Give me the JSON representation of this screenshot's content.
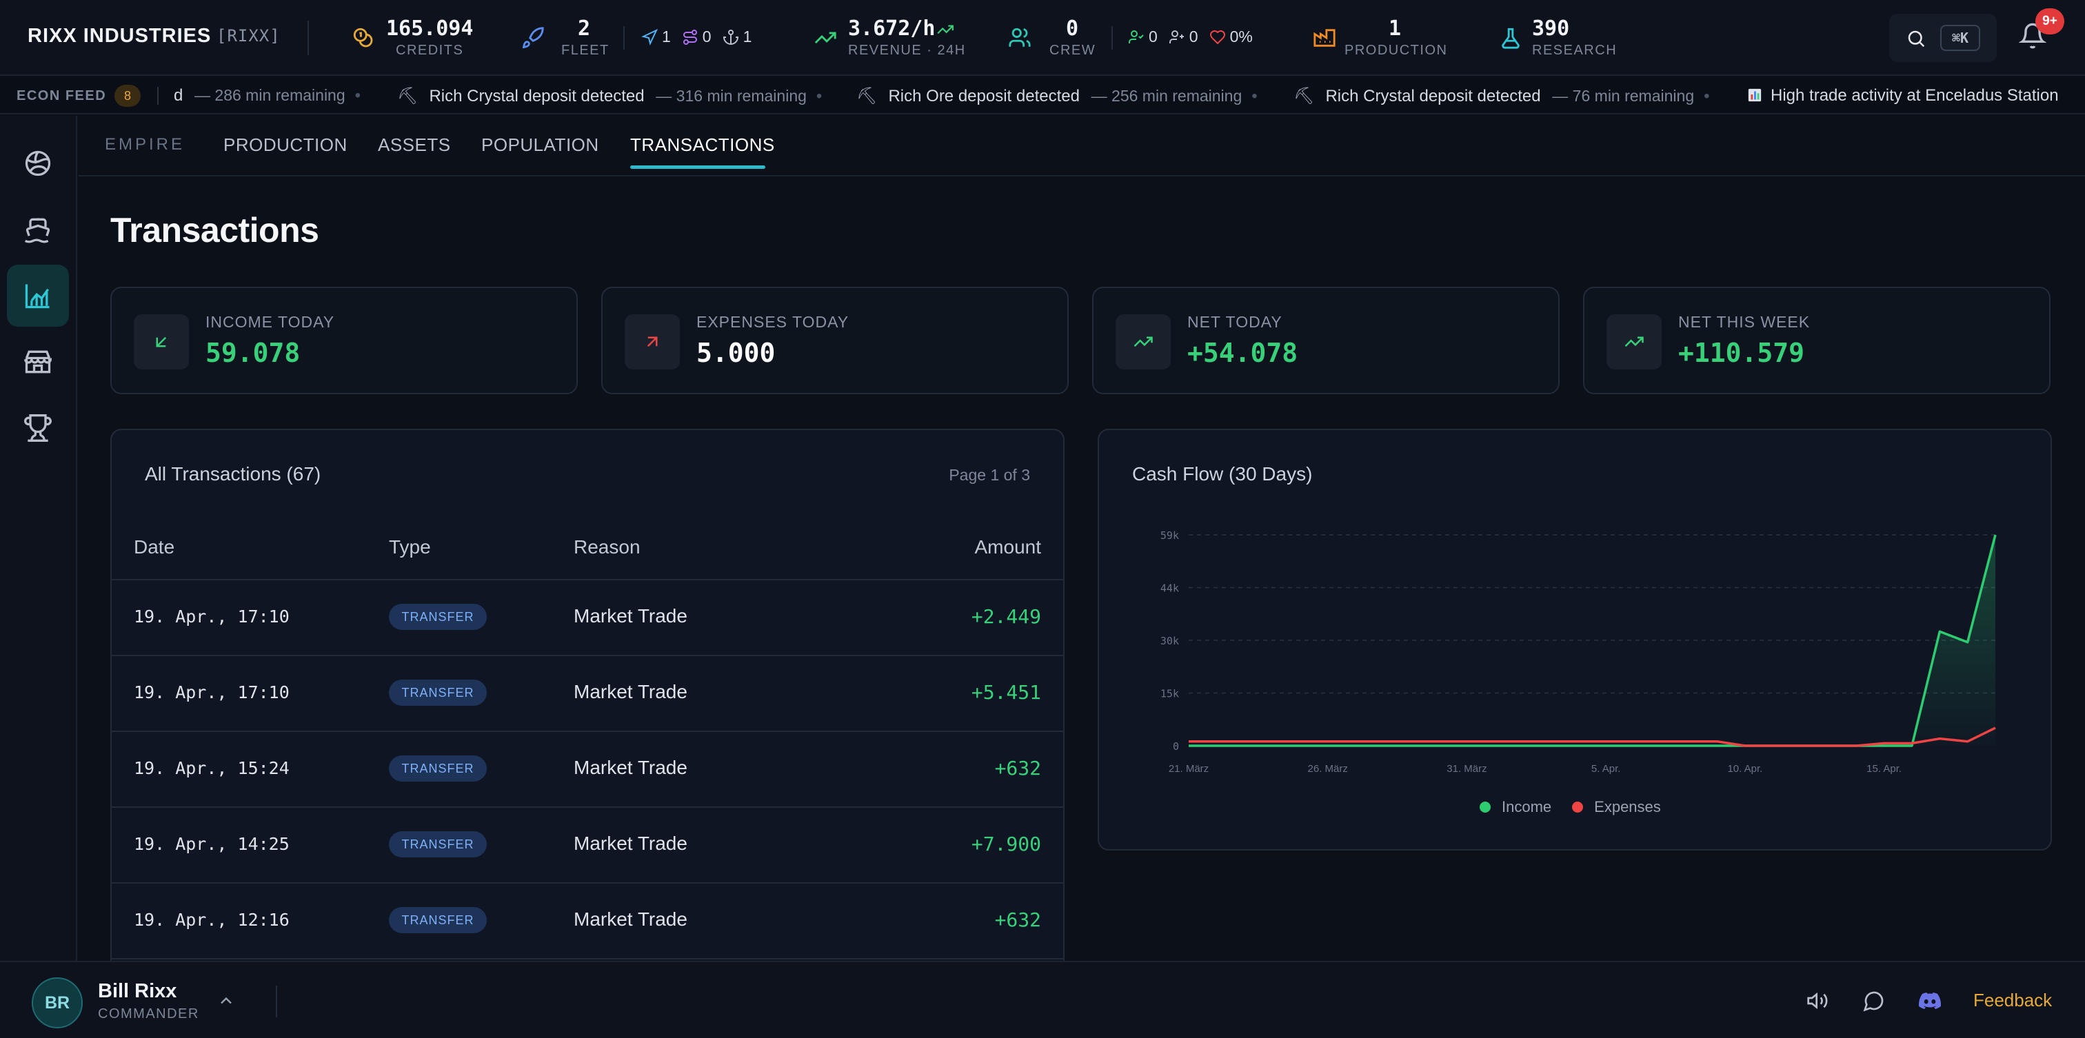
{
  "header": {
    "brand": "RIXX INDUSTRIES",
    "brand_tag": "[RIXX]",
    "credits": {
      "value": "165.094",
      "label": "CREDITS"
    },
    "fleet": {
      "value": "2",
      "label": "FLEET"
    },
    "fleet_mini": [
      "1",
      "0",
      "1"
    ],
    "revenue": {
      "value": "3.672/h",
      "label": "REVENUE · 24H"
    },
    "crew": {
      "value": "0",
      "label": "CREW"
    },
    "crew_mini": [
      "0",
      "0",
      "0%"
    ],
    "production": {
      "value": "1",
      "label": "PRODUCTION"
    },
    "research": {
      "value": "390",
      "label": "RESEARCH"
    },
    "search_shortcut": "⌘K",
    "notification_badge": "9+"
  },
  "ticker": {
    "label": "ECON FEED",
    "count": "8",
    "items": [
      {
        "text": "d",
        "remaining": "— 286 min remaining"
      },
      {
        "text": "Rich Crystal deposit detected",
        "remaining": "— 316 min remaining"
      },
      {
        "text": "Rich Ore deposit detected",
        "remaining": "— 256 min remaining"
      },
      {
        "text": "Rich Crystal deposit detected",
        "remaining": "— 76 min remaining"
      },
      {
        "text": "High trade activity at Enceladus Station",
        "remaining": ""
      }
    ]
  },
  "sidebar": {
    "items": [
      {
        "name": "galaxy",
        "icon": "planet-icon"
      },
      {
        "name": "ships",
        "icon": "ship-icon"
      },
      {
        "name": "empire",
        "icon": "factory-icon"
      },
      {
        "name": "market",
        "icon": "store-icon"
      },
      {
        "name": "leaderboard",
        "icon": "trophy-icon"
      }
    ]
  },
  "subnav": {
    "section": "EMPIRE",
    "tabs": [
      "PRODUCTION",
      "ASSETS",
      "POPULATION",
      "TRANSACTIONS"
    ],
    "active": "TRANSACTIONS"
  },
  "page": {
    "title": "Transactions"
  },
  "cards": [
    {
      "label": "INCOME TODAY",
      "value": "59.078",
      "color": "#38d17a"
    },
    {
      "label": "EXPENSES TODAY",
      "value": "5.000",
      "color": "#ffffff"
    },
    {
      "label": "NET TODAY",
      "value": "+54.078",
      "color": "#38d17a"
    },
    {
      "label": "NET THIS WEEK",
      "value": "+110.579",
      "color": "#38d17a"
    }
  ],
  "transactions": {
    "title": "All Transactions (67)",
    "page_info": "Page 1 of 3",
    "columns": [
      "Date",
      "Type",
      "Reason",
      "Amount"
    ],
    "rows": [
      {
        "date": "19. Apr., 17:10",
        "type": "TRANSFER",
        "reason": "Market Trade",
        "amount": "+2.449"
      },
      {
        "date": "19. Apr., 17:10",
        "type": "TRANSFER",
        "reason": "Market Trade",
        "amount": "+5.451"
      },
      {
        "date": "19. Apr., 15:24",
        "type": "TRANSFER",
        "reason": "Market Trade",
        "amount": "+632"
      },
      {
        "date": "19. Apr., 14:25",
        "type": "TRANSFER",
        "reason": "Market Trade",
        "amount": "+7.900"
      },
      {
        "date": "19. Apr., 12:16",
        "type": "TRANSFER",
        "reason": "Market Trade",
        "amount": "+632"
      }
    ]
  },
  "cashflow": {
    "title": "Cash Flow (30 Days)"
  },
  "chart_data": {
    "type": "line",
    "title": "Cash Flow (30 Days)",
    "xlabel": "",
    "ylabel": "",
    "x": [
      "21. März",
      "22. März",
      "23. März",
      "24. März",
      "25. März",
      "26. März",
      "27. März",
      "28. März",
      "29. März",
      "30. März",
      "31. März",
      "1. Apr.",
      "2. Apr.",
      "3. Apr.",
      "4. Apr.",
      "5. Apr.",
      "6. Apr.",
      "7. Apr.",
      "8. Apr.",
      "9. Apr.",
      "10. Apr.",
      "11. Apr.",
      "12. Apr.",
      "13. Apr.",
      "14. Apr.",
      "15. Apr.",
      "16. Apr.",
      "17. Apr.",
      "18. Apr.",
      "19. Apr."
    ],
    "x_ticks": [
      "21. März",
      "26. März",
      "31. März",
      "5. Apr.",
      "10. Apr.",
      "15. Apr."
    ],
    "y_ticks": [
      "0",
      "15k",
      "30k",
      "44k",
      "59k"
    ],
    "ylim": [
      0,
      59078
    ],
    "grid": true,
    "legend": "bottom-center",
    "series": [
      {
        "name": "Income",
        "color": "#2ecc71",
        "values": [
          0,
          0,
          0,
          0,
          0,
          0,
          0,
          0,
          0,
          0,
          0,
          0,
          0,
          0,
          0,
          0,
          0,
          0,
          0,
          0,
          0,
          0,
          0,
          0,
          0,
          0,
          0,
          32000,
          29000,
          59078
        ]
      },
      {
        "name": "Expenses",
        "color": "#ef4444",
        "values": [
          1200,
          1200,
          1200,
          1200,
          1200,
          1200,
          1200,
          1200,
          1200,
          1200,
          1200,
          1200,
          1200,
          1200,
          1200,
          1200,
          1200,
          1200,
          1200,
          1200,
          0,
          0,
          0,
          0,
          0,
          700,
          700,
          2000,
          1200,
          5000
        ]
      }
    ]
  },
  "footer": {
    "initials": "BR",
    "name": "Bill Rixx",
    "role": "COMMANDER",
    "feedback": "Feedback"
  }
}
